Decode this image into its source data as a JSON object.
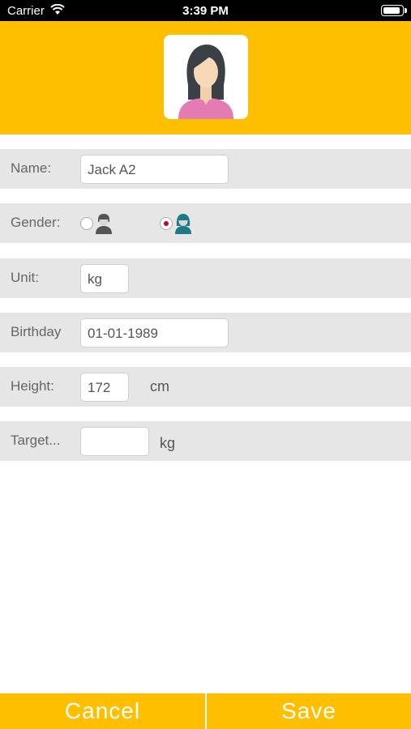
{
  "status_bar": {
    "carrier": "Carrier",
    "time": "3:39 PM"
  },
  "profile": {
    "avatar_icon": "female-user-icon"
  },
  "form": {
    "name_label": "Name:",
    "name_value": "Jack A2",
    "gender_label": "Gender:",
    "gender_options": [
      {
        "icon": "male-user-icon",
        "selected": false
      },
      {
        "icon": "female-user-icon",
        "selected": true
      }
    ],
    "unit_label": "Unit:",
    "unit_value": "kg",
    "birthday_label": "Birthday",
    "birthday_value": "01-01-1989",
    "height_label": "Height:",
    "height_value": "172",
    "height_unit": "cm",
    "target_label": "Target...",
    "target_value": "",
    "target_unit": "kg"
  },
  "footer": {
    "cancel_label": "Cancel",
    "save_label": "Save"
  },
  "colors": {
    "accent": "#fdbf00",
    "row_bg": "#e6e6e6",
    "radio_selected": "#d0021b"
  }
}
